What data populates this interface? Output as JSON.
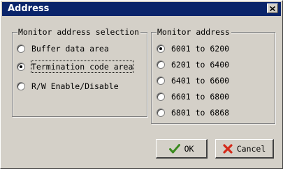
{
  "dialog": {
    "title": "Address",
    "close_icon": "close-icon"
  },
  "monitor_selection": {
    "legend": "Monitor address selection",
    "options": [
      {
        "label": "Buffer data area",
        "checked": false
      },
      {
        "label": "Termination code area",
        "checked": true
      },
      {
        "label": "R/W Enable/Disable",
        "checked": false
      }
    ]
  },
  "monitor_address": {
    "legend": "Monitor address",
    "options": [
      {
        "label": "6001 to 6200",
        "checked": true
      },
      {
        "label": "6201 to 6400",
        "checked": false
      },
      {
        "label": "6401 to 6600",
        "checked": false
      },
      {
        "label": "6601 to 6800",
        "checked": false
      },
      {
        "label": "6801 to 6868",
        "checked": false
      }
    ]
  },
  "buttons": {
    "ok_label": "OK",
    "ok_icon": "checkmark-icon",
    "ok_icon_color": "#3a8a1e",
    "cancel_label": "Cancel",
    "cancel_icon": "x-icon",
    "cancel_icon_color": "#d42a1a"
  },
  "colors": {
    "titlebar": "#0a246a",
    "face": "#d4d0c8"
  }
}
